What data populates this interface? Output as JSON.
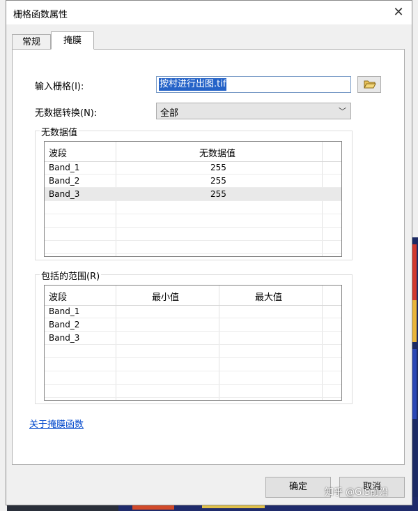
{
  "window": {
    "title": "栅格函数属性",
    "close_glyph": "✕"
  },
  "tabs": [
    {
      "label": "常规",
      "active": false
    },
    {
      "label": "掩膜",
      "active": true
    }
  ],
  "form": {
    "input_raster_label": "输入栅格(I):",
    "input_raster_value": "按村进行出图.tif",
    "nodata_convert_label": "无数据转换(N):",
    "nodata_convert_value": "全部"
  },
  "nodata_group": {
    "title": "无数据值",
    "columns": [
      "波段",
      "无数据值"
    ],
    "rows": [
      {
        "band": "Band_1",
        "value": "255"
      },
      {
        "band": "Band_2",
        "value": "255"
      },
      {
        "band": "Band_3",
        "value": "255"
      }
    ]
  },
  "range_group": {
    "title": "包括的范围(R)",
    "columns": [
      "波段",
      "最小值",
      "最大值"
    ],
    "rows": [
      {
        "band": "Band_1",
        "min": "",
        "max": ""
      },
      {
        "band": "Band_2",
        "min": "",
        "max": ""
      },
      {
        "band": "Band_3",
        "min": "",
        "max": ""
      }
    ]
  },
  "link": {
    "label": "关于掩膜函数"
  },
  "buttons": {
    "ok": "确定",
    "cancel": "取消"
  },
  "watermark": "知乎 @GIS前沿",
  "colors": {
    "selection": "#2563c8",
    "link": "#0047cc"
  }
}
